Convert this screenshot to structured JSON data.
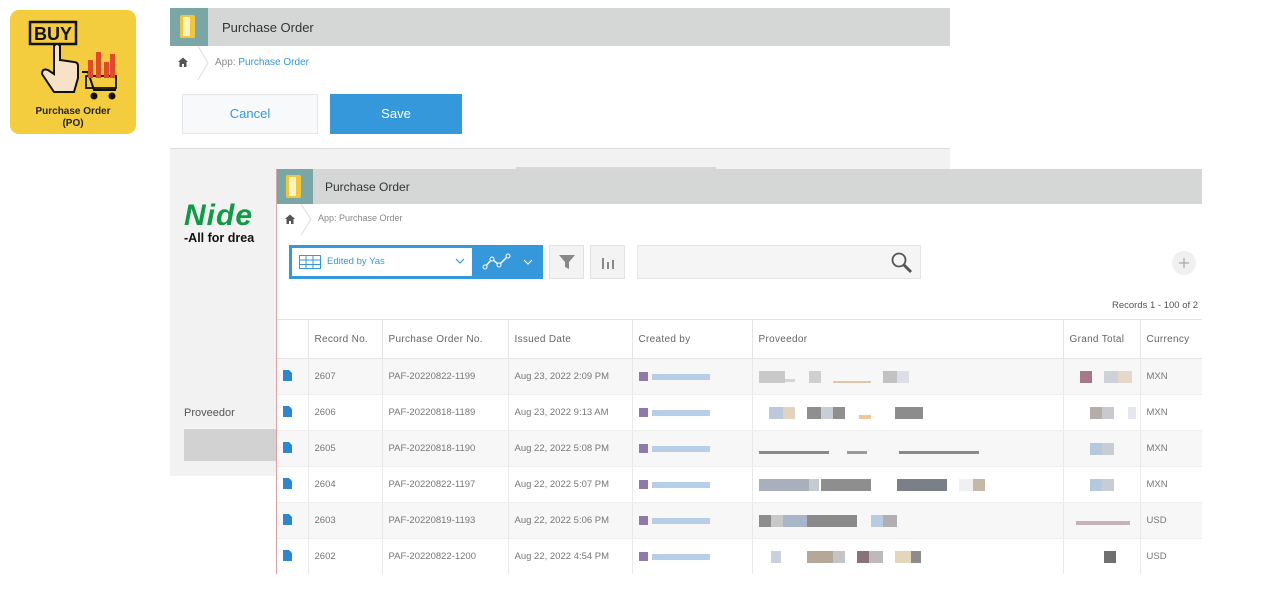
{
  "logo": {
    "big_text": "BUY",
    "caption_line1": "Purchase Order",
    "caption_line2": "(PO)"
  },
  "back_window": {
    "title": "Purchase Order",
    "breadcrumb_prefix": "App:",
    "breadcrumb_link": "Purchase Order",
    "cancel_label": "Cancel",
    "save_label": "Save",
    "company_logo_word": "Nide",
    "company_logo_tag": "-All for drea",
    "provider_label": "Proveedor"
  },
  "front_window": {
    "title": "Purchase Order",
    "breadcrumb": "App: Purchase Order",
    "view_label": "Edited by Yas",
    "records_count": "Records 1 - 100 of 2",
    "columns": [
      "Record No.",
      "Purchase Order No.",
      "Issued Date",
      "Created by",
      "Proveedor",
      "Grand Total",
      "Currency"
    ],
    "rows": [
      {
        "record_no": "2607",
        "po_no": "PAF-20220822-1199",
        "issued": "Aug 23, 2022 2:09 PM",
        "currency": "MXN"
      },
      {
        "record_no": "2606",
        "po_no": "PAF-20220818-1189",
        "issued": "Aug 23, 2022 9:13 AM",
        "currency": "MXN"
      },
      {
        "record_no": "2605",
        "po_no": "PAF-20220818-1190",
        "issued": "Aug 22, 2022 5:08 PM",
        "currency": "MXN"
      },
      {
        "record_no": "2604",
        "po_no": "PAF-20220822-1197",
        "issued": "Aug 22, 2022 5:07 PM",
        "currency": "MXN"
      },
      {
        "record_no": "2603",
        "po_no": "PAF-20220819-1193",
        "issued": "Aug 22, 2022 5:06 PM",
        "currency": "USD"
      },
      {
        "record_no": "2602",
        "po_no": "PAF-20220822-1200",
        "issued": "Aug 22, 2022 4:54 PM",
        "currency": "USD"
      }
    ]
  },
  "colors": {
    "accent_blue": "#3498db",
    "titlebar_gray": "#d4d7d6",
    "logo_yellow": "#f4cd3f",
    "logo_green": "#0f9a45"
  },
  "icons": [
    "home-icon",
    "grid-view-icon",
    "chevron-down-icon",
    "graph-icon",
    "filter-icon",
    "bar-chart-icon",
    "search-icon",
    "plus-icon",
    "document-icon"
  ]
}
